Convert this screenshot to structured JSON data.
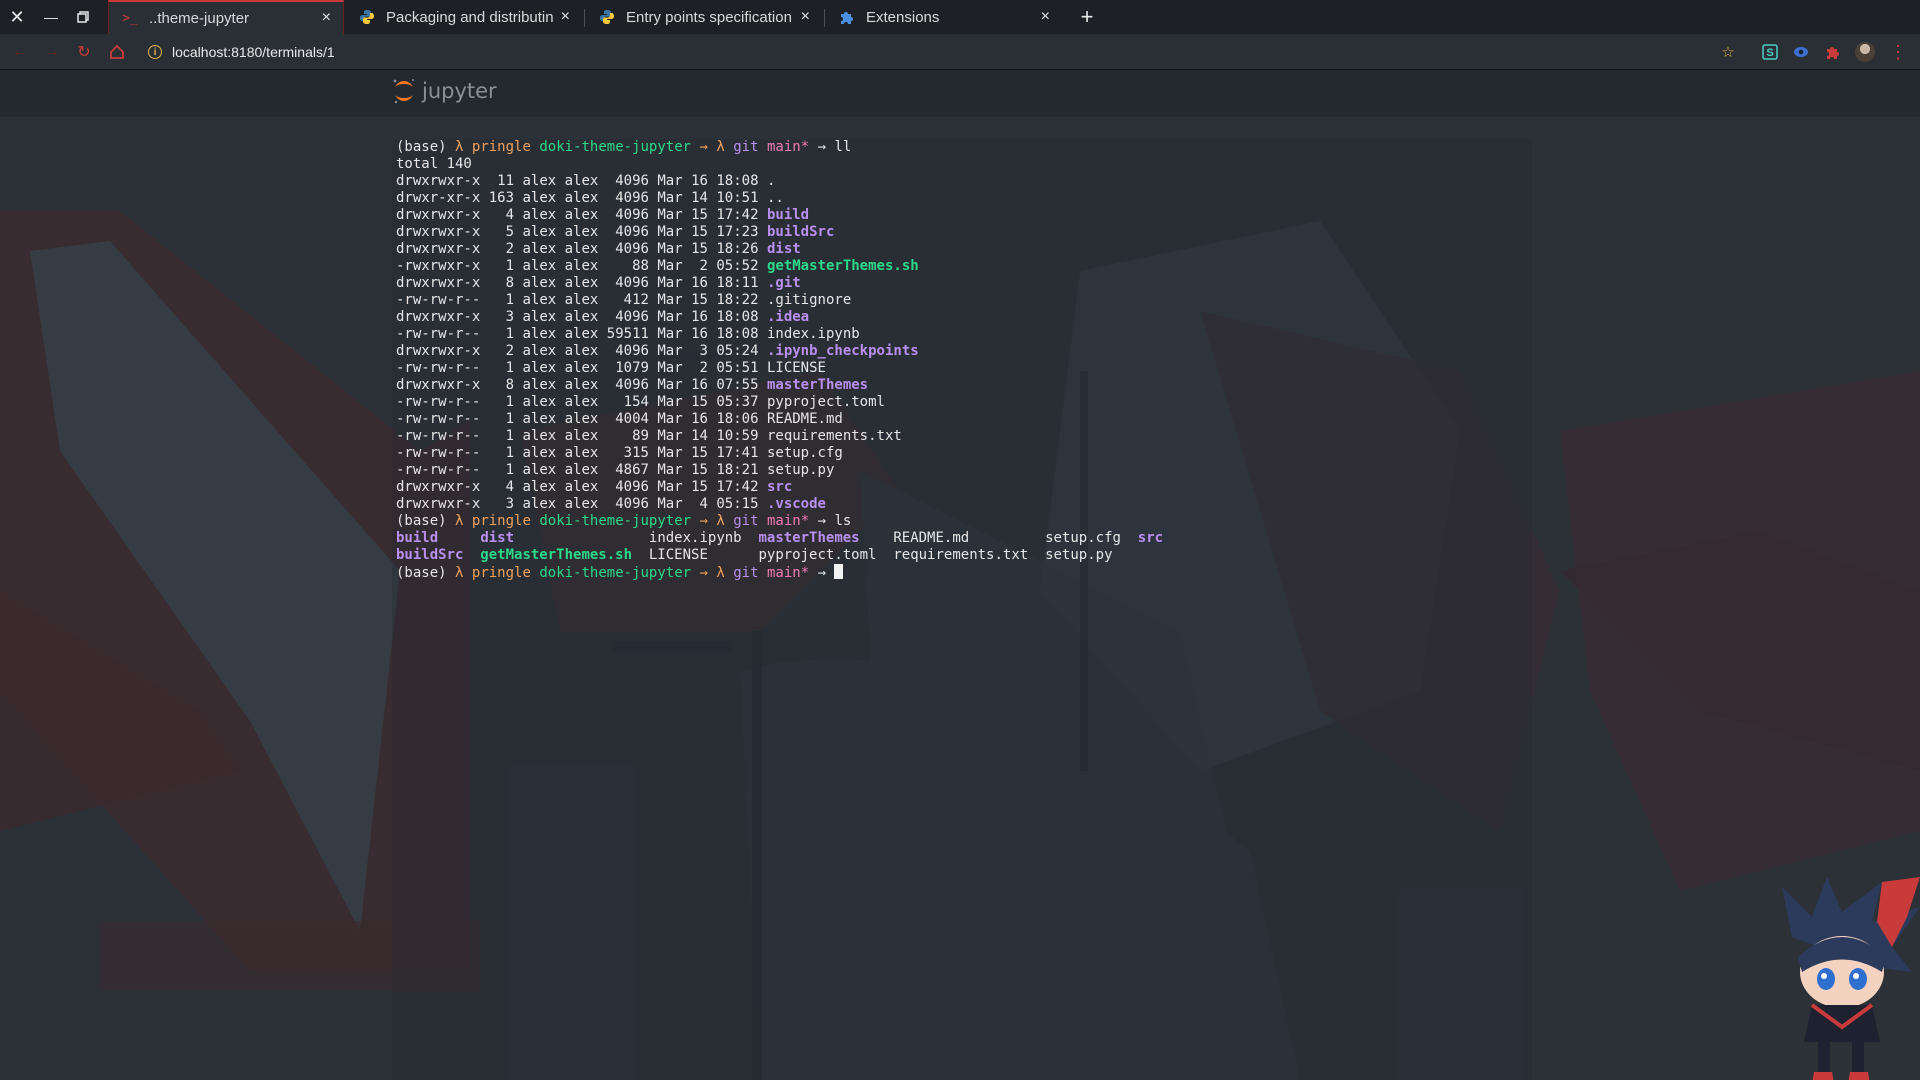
{
  "browser": {
    "tabs": [
      {
        "title": "..theme-jupyter",
        "icon": "terminal-icon"
      },
      {
        "title": "Packaging and distributin",
        "icon": "python-icon"
      },
      {
        "title": "Entry points specification",
        "icon": "python-icon"
      },
      {
        "title": "Extensions",
        "icon": "puzzle-icon"
      }
    ],
    "new_tab": "+",
    "close_glyph": "×",
    "url": "localhost:8180/terminals/1",
    "accent": "#c93b3b"
  },
  "jupyter": {
    "logo_text": "jupyter"
  },
  "terminal": {
    "prompt": {
      "env": "(base)",
      "lambda": "λ",
      "user": "pringle",
      "dir": "doki-theme-jupyter",
      "arrow": "→",
      "git": "git",
      "branch": "main*"
    },
    "cmd1": "ll",
    "total": "total 140",
    "listing": [
      {
        "perm": "drwxrwxr-x",
        "links": "11",
        "user": "alex",
        "group": "alex",
        "size": "4096",
        "date": "Mar 16 18:08",
        "name": ".",
        "kind": "plain"
      },
      {
        "perm": "drwxr-xr-x",
        "links": "163",
        "user": "alex",
        "group": "alex",
        "size": "4096",
        "date": "Mar 14 10:51",
        "name": "..",
        "kind": "plain"
      },
      {
        "perm": "drwxrwxr-x",
        "links": "4",
        "user": "alex",
        "group": "alex",
        "size": "4096",
        "date": "Mar 15 17:42",
        "name": "build",
        "kind": "dir"
      },
      {
        "perm": "drwxrwxr-x",
        "links": "5",
        "user": "alex",
        "group": "alex",
        "size": "4096",
        "date": "Mar 15 17:23",
        "name": "buildSrc",
        "kind": "dir"
      },
      {
        "perm": "drwxrwxr-x",
        "links": "2",
        "user": "alex",
        "group": "alex",
        "size": "4096",
        "date": "Mar 15 18:26",
        "name": "dist",
        "kind": "dir"
      },
      {
        "perm": "-rwxrwxr-x",
        "links": "1",
        "user": "alex",
        "group": "alex",
        "size": "88",
        "date": "Mar  2 05:52",
        "name": "getMasterThemes.sh",
        "kind": "exe"
      },
      {
        "perm": "drwxrwxr-x",
        "links": "8",
        "user": "alex",
        "group": "alex",
        "size": "4096",
        "date": "Mar 16 18:11",
        "name": ".git",
        "kind": "dir"
      },
      {
        "perm": "-rw-rw-r--",
        "links": "1",
        "user": "alex",
        "group": "alex",
        "size": "412",
        "date": "Mar 15 18:22",
        "name": ".gitignore",
        "kind": "plain"
      },
      {
        "perm": "drwxrwxr-x",
        "links": "3",
        "user": "alex",
        "group": "alex",
        "size": "4096",
        "date": "Mar 16 18:08",
        "name": ".idea",
        "kind": "dir"
      },
      {
        "perm": "-rw-rw-r--",
        "links": "1",
        "user": "alex",
        "group": "alex",
        "size": "59511",
        "date": "Mar 16 18:08",
        "name": "index.ipynb",
        "kind": "plain"
      },
      {
        "perm": "drwxrwxr-x",
        "links": "2",
        "user": "alex",
        "group": "alex",
        "size": "4096",
        "date": "Mar  3 05:24",
        "name": ".ipynb_checkpoints",
        "kind": "dir"
      },
      {
        "perm": "-rw-rw-r--",
        "links": "1",
        "user": "alex",
        "group": "alex",
        "size": "1079",
        "date": "Mar  2 05:51",
        "name": "LICENSE",
        "kind": "plain"
      },
      {
        "perm": "drwxrwxr-x",
        "links": "8",
        "user": "alex",
        "group": "alex",
        "size": "4096",
        "date": "Mar 16 07:55",
        "name": "masterThemes",
        "kind": "dir"
      },
      {
        "perm": "-rw-rw-r--",
        "links": "1",
        "user": "alex",
        "group": "alex",
        "size": "154",
        "date": "Mar 15 05:37",
        "name": "pyproject.toml",
        "kind": "plain"
      },
      {
        "perm": "-rw-rw-r--",
        "links": "1",
        "user": "alex",
        "group": "alex",
        "size": "4004",
        "date": "Mar 16 18:06",
        "name": "README.md",
        "kind": "plain"
      },
      {
        "perm": "-rw-rw-r--",
        "links": "1",
        "user": "alex",
        "group": "alex",
        "size": "89",
        "date": "Mar 14 10:59",
        "name": "requirements.txt",
        "kind": "plain"
      },
      {
        "perm": "-rw-rw-r--",
        "links": "1",
        "user": "alex",
        "group": "alex",
        "size": "315",
        "date": "Mar 15 17:41",
        "name": "setup.cfg",
        "kind": "plain"
      },
      {
        "perm": "-rw-rw-r--",
        "links": "1",
        "user": "alex",
        "group": "alex",
        "size": "4867",
        "date": "Mar 15 18:21",
        "name": "setup.py",
        "kind": "plain"
      },
      {
        "perm": "drwxrwxr-x",
        "links": "4",
        "user": "alex",
        "group": "alex",
        "size": "4096",
        "date": "Mar 15 17:42",
        "name": "src",
        "kind": "dir"
      },
      {
        "perm": "drwxrwxr-x",
        "links": "3",
        "user": "alex",
        "group": "alex",
        "size": "4096",
        "date": "Mar  4 05:15",
        "name": ".vscode",
        "kind": "dir"
      }
    ],
    "cmd2": "ls",
    "ls_rows": [
      [
        {
          "name": "build",
          "kind": "dir"
        },
        {
          "name": "dist",
          "kind": "dir"
        },
        {
          "name": "index.ipynb",
          "kind": "plain"
        },
        {
          "name": "masterThemes",
          "kind": "dir"
        },
        {
          "name": "README.md",
          "kind": "plain"
        },
        {
          "name": "setup.cfg",
          "kind": "plain"
        },
        {
          "name": "src",
          "kind": "dir"
        }
      ],
      [
        {
          "name": "buildSrc",
          "kind": "dir"
        },
        {
          "name": "getMasterThemes.sh",
          "kind": "exe"
        },
        {
          "name": "LICENSE",
          "kind": "plain"
        },
        {
          "name": "pyproject.toml",
          "kind": "plain"
        },
        {
          "name": "requirements.txt",
          "kind": "plain"
        },
        {
          "name": "setup.py",
          "kind": "plain"
        }
      ]
    ],
    "colors": {
      "prompt_orange": "#f0a15b",
      "dir_green": "#2bd98a",
      "git_purple": "#b98ff0",
      "branch_pink": "#f07ab8"
    }
  }
}
